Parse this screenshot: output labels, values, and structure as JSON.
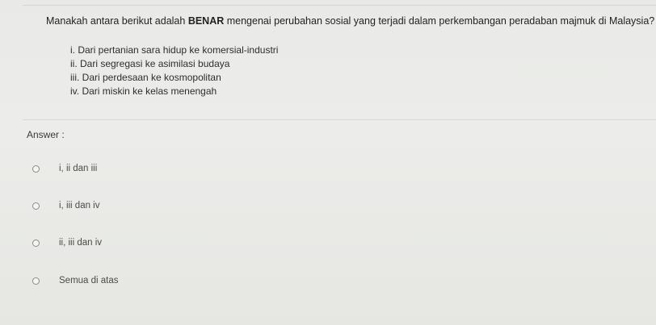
{
  "question": {
    "prefix": "Manakah antara berikut adalah ",
    "emphasis": "BENAR",
    "suffix": " mengenai perubahan sosial yang terjadi dalam perkembangan peradaban majmuk di Malaysia?",
    "statements": [
      "i. Dari pertanian sara hidup ke komersial-industri",
      "ii. Dari segregasi ke asimilasi budaya",
      "iii. Dari perdesaan ke kosmopolitan",
      "iv. Dari miskin ke kelas menengah"
    ]
  },
  "answer": {
    "label": "Answer :",
    "options": [
      "i, ii dan iii",
      "i, iii dan iv",
      "ii, iii dan iv",
      "Semua di atas"
    ]
  }
}
